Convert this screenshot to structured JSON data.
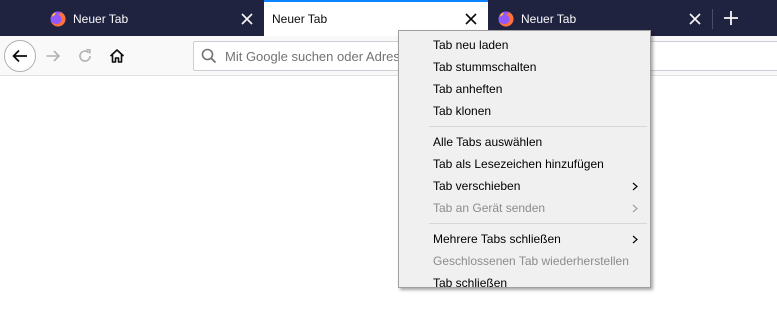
{
  "tabs": [
    {
      "title": "Neuer Tab",
      "selected": false,
      "has_favicon": true,
      "favicon_icon": "firefox-icon"
    },
    {
      "title": "Neuer Tab",
      "selected": true,
      "has_favicon": false
    },
    {
      "title": "Neuer Tab",
      "selected": false,
      "has_favicon": true,
      "favicon_icon": "firefox-icon"
    }
  ],
  "toolbar": {
    "back_icon": "arrow-left-icon",
    "forward_icon": "arrow-right-icon",
    "reload_icon": "reload-icon",
    "home_icon": "home-icon",
    "search_placeholder": "Mit Google suchen oder Adresse eingeben"
  },
  "context_menu": {
    "groups": [
      [
        {
          "label": "Tab neu laden",
          "enabled": true
        },
        {
          "label": "Tab stummschalten",
          "enabled": true
        },
        {
          "label": "Tab anheften",
          "enabled": true
        },
        {
          "label": "Tab klonen",
          "enabled": true
        }
      ],
      [
        {
          "label": "Alle Tabs auswählen",
          "enabled": true
        },
        {
          "label": "Tab als Lesezeichen hinzufügen",
          "enabled": true
        },
        {
          "label": "Tab verschieben",
          "enabled": true,
          "submenu": true
        },
        {
          "label": "Tab an Gerät senden",
          "enabled": false,
          "submenu": true
        }
      ],
      [
        {
          "label": "Mehrere Tabs schließen",
          "enabled": true,
          "submenu": true
        },
        {
          "label": "Geschlossenen Tab wiederherstellen",
          "enabled": false
        },
        {
          "label": "Tab schließen",
          "enabled": true
        }
      ]
    ]
  },
  "colors": {
    "tabstrip_bg": "#202340",
    "selected_tab_accent": "#0a84ff",
    "menu_bg": "#f0f0f0"
  }
}
